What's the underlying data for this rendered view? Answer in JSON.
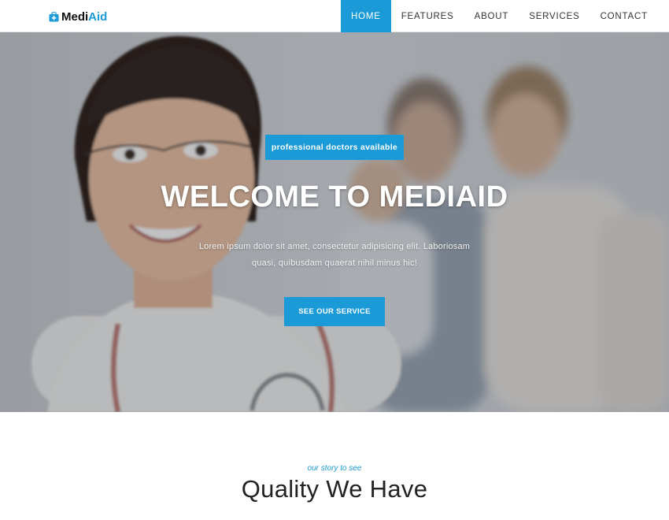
{
  "brand": {
    "name_part1": "Medi",
    "name_part2": "Aid",
    "icon": "medical-kit-icon",
    "accent_color": "#1a9ad6"
  },
  "nav": {
    "items": [
      {
        "label": "HOME",
        "active": true
      },
      {
        "label": "FEATURES",
        "active": false
      },
      {
        "label": "ABOUT",
        "active": false
      },
      {
        "label": "SERVICES",
        "active": false
      },
      {
        "label": "CONTACT",
        "active": false
      }
    ]
  },
  "hero": {
    "badge": "professional doctors available",
    "title": "WELCOME TO MEDIAID",
    "text": "Lorem ipsum dolor sit amet, consectetur adipisicing elit. Laboriosam quasi, quibusdam quaerat nihil minus hic!",
    "button_label": "SEE OUR SERVICE"
  },
  "section": {
    "tagline": "our story to see",
    "title": "Quality We Have"
  }
}
